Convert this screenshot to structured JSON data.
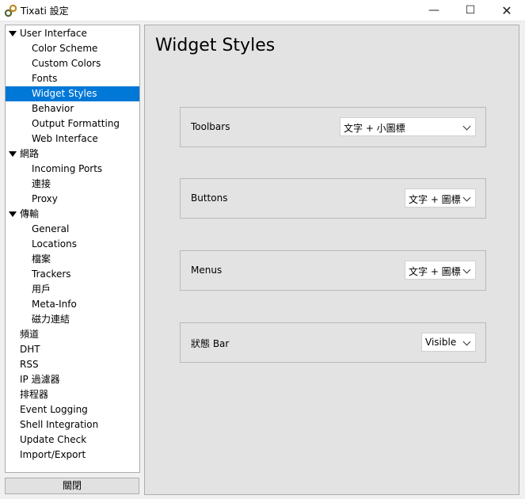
{
  "window": {
    "title": "Tixati 設定",
    "minimize": "—",
    "maximize": "☐",
    "close": "✕"
  },
  "tree": {
    "items": [
      {
        "label": "User Interface",
        "level": 0,
        "expandable": true
      },
      {
        "label": "Color Scheme",
        "level": 1
      },
      {
        "label": "Custom Colors",
        "level": 1
      },
      {
        "label": "Fonts",
        "level": 1
      },
      {
        "label": "Widget Styles",
        "level": 1,
        "selected": true
      },
      {
        "label": "Behavior",
        "level": 1
      },
      {
        "label": "Output Formatting",
        "level": 1
      },
      {
        "label": "Web Interface",
        "level": 1
      },
      {
        "label": "網路",
        "level": 0,
        "expandable": true
      },
      {
        "label": "Incoming Ports",
        "level": 1
      },
      {
        "label": "連接",
        "level": 1
      },
      {
        "label": "Proxy",
        "level": 1
      },
      {
        "label": "傳輸",
        "level": 0,
        "expandable": true
      },
      {
        "label": "General",
        "level": 1
      },
      {
        "label": "Locations",
        "level": 1
      },
      {
        "label": "檔案",
        "level": 1
      },
      {
        "label": "Trackers",
        "level": 1
      },
      {
        "label": "用戶",
        "level": 1
      },
      {
        "label": "Meta-Info",
        "level": 1
      },
      {
        "label": "磁力連結",
        "level": 1
      },
      {
        "label": "頻道",
        "level": 0
      },
      {
        "label": "DHT",
        "level": 0
      },
      {
        "label": "RSS",
        "level": 0
      },
      {
        "label": "IP 過濾器",
        "level": 0
      },
      {
        "label": "排程器",
        "level": 0
      },
      {
        "label": "Event Logging",
        "level": 0
      },
      {
        "label": "Shell Integration",
        "level": 0
      },
      {
        "label": "Update Check",
        "level": 0
      },
      {
        "label": "Import/Export",
        "level": 0
      }
    ]
  },
  "close_button": "關閉",
  "main": {
    "title": "Widget Styles",
    "settings": [
      {
        "label": "Toolbars",
        "value": "文字 + 小圖標"
      },
      {
        "label": "Buttons",
        "value": "文字 + 圖標"
      },
      {
        "label": "Menus",
        "value": "文字 + 圖標"
      },
      {
        "label": "狀態 Bar",
        "value": "Visible"
      }
    ]
  },
  "colors": {
    "selection": "#0078d7",
    "panel": "#e3e3e3",
    "window": "#f0f0f0"
  }
}
